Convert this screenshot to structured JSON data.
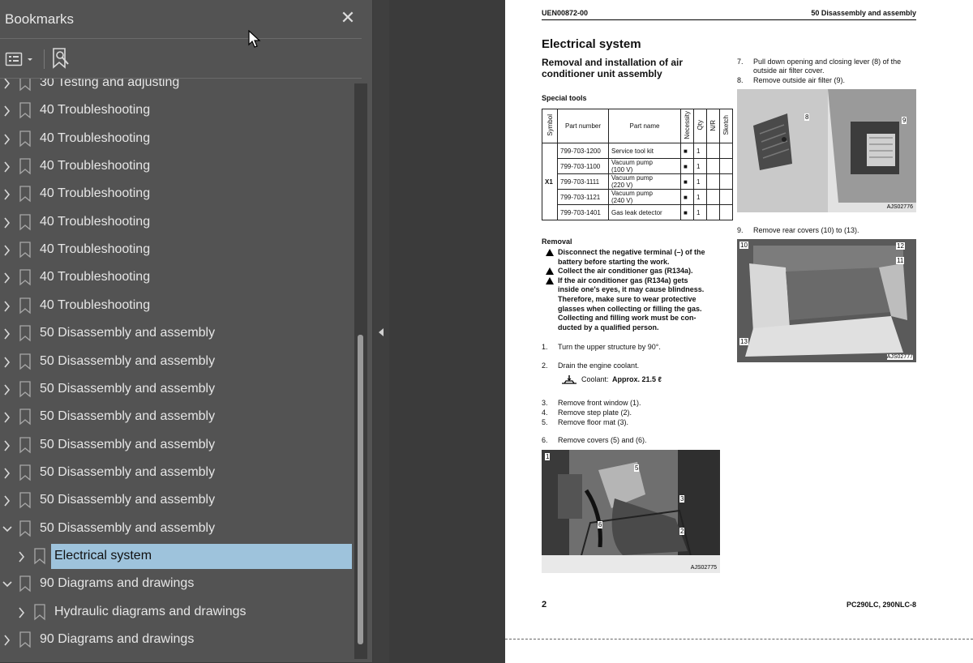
{
  "panel": {
    "title": "Bookmarks",
    "close_symbol": "✕"
  },
  "bookmarks": [
    {
      "label": "30 Testing and adjusting",
      "level": 0,
      "state": "collapsed"
    },
    {
      "label": "40 Troubleshooting",
      "level": 0,
      "state": "collapsed"
    },
    {
      "label": "40 Troubleshooting",
      "level": 0,
      "state": "collapsed"
    },
    {
      "label": "40 Troubleshooting",
      "level": 0,
      "state": "collapsed"
    },
    {
      "label": "40 Troubleshooting",
      "level": 0,
      "state": "collapsed"
    },
    {
      "label": "40 Troubleshooting",
      "level": 0,
      "state": "collapsed"
    },
    {
      "label": "40 Troubleshooting",
      "level": 0,
      "state": "collapsed"
    },
    {
      "label": "40 Troubleshooting",
      "level": 0,
      "state": "collapsed"
    },
    {
      "label": "40 Troubleshooting",
      "level": 0,
      "state": "collapsed"
    },
    {
      "label": "50 Disassembly and assembly",
      "level": 0,
      "state": "collapsed"
    },
    {
      "label": "50 Disassembly and assembly",
      "level": 0,
      "state": "collapsed"
    },
    {
      "label": "50 Disassembly and assembly",
      "level": 0,
      "state": "collapsed"
    },
    {
      "label": "50 Disassembly and assembly",
      "level": 0,
      "state": "collapsed"
    },
    {
      "label": "50 Disassembly and assembly",
      "level": 0,
      "state": "collapsed"
    },
    {
      "label": "50 Disassembly and assembly",
      "level": 0,
      "state": "collapsed"
    },
    {
      "label": "50 Disassembly and assembly",
      "level": 0,
      "state": "collapsed"
    },
    {
      "label": "50 Disassembly and assembly",
      "level": 0,
      "state": "expanded"
    },
    {
      "label": "Electrical system",
      "level": 1,
      "state": "collapsed",
      "selected": true
    },
    {
      "label": "90 Diagrams and drawings",
      "level": 0,
      "state": "expanded"
    },
    {
      "label": "Hydraulic diagrams and drawings",
      "level": 1,
      "state": "collapsed"
    },
    {
      "label": "90 Diagrams and drawings",
      "level": 0,
      "state": "collapsed"
    }
  ],
  "colors": {
    "panel_bg": "#535353",
    "selection_bg": "#9ec3dc",
    "viewer_bg": "#3b3b3b"
  },
  "doc": {
    "header_left": "UEN00872-00",
    "header_right": "50 Disassembly and assembly",
    "section_title": "Electrical system",
    "subtitle_line1": "Removal and installation of air",
    "subtitle_line2": "conditioner unit assembly",
    "special_tools": "Special tools",
    "table": {
      "headers": [
        "Symbol",
        "Part number",
        "Part name",
        "Necessity",
        "Qty",
        "N/R",
        "Sketch"
      ],
      "symbol": "X1",
      "rows": [
        {
          "part_number": "799-703-1200",
          "part_name": [
            "Service tool kit"
          ],
          "necessity": "■",
          "qty": "1"
        },
        {
          "part_number": "799-703-1100",
          "part_name": [
            "Vacuum pump",
            "(100 V)"
          ],
          "necessity": "■",
          "qty": "1"
        },
        {
          "part_number": "799-703-1111",
          "part_name": [
            "Vacuum pump",
            "(220 V)"
          ],
          "necessity": "■",
          "qty": "1"
        },
        {
          "part_number": "799-703-1121",
          "part_name": [
            "Vacuum pump",
            "(240 V)"
          ],
          "necessity": "■",
          "qty": "1"
        },
        {
          "part_number": "799-703-1401",
          "part_name": [
            "Gas leak detector"
          ],
          "necessity": "■",
          "qty": "1"
        }
      ]
    },
    "removal": "Removal",
    "warnings": [
      [
        "Disconnect the negative terminal (–) of the",
        "battery before starting the work."
      ],
      [
        "Collect the air conditioner gas (R134a)."
      ],
      [
        "If the air conditioner gas (R134a) gets",
        "inside one's eyes, it may cause blindness.",
        "Therefore, make sure to wear protective",
        "glasses when collecting or filling the gas.",
        "Collecting and filling work must be con-",
        "ducted by a qualified person."
      ]
    ],
    "steps_left": [
      {
        "num": "1.",
        "text": "Turn the upper structure by 90°."
      },
      {
        "num": "2.",
        "text": "Drain the engine coolant."
      },
      {
        "num": "3.",
        "text": "Remove front window (1)."
      },
      {
        "num": "4.",
        "text": "Remove step plate (2)."
      },
      {
        "num": "5.",
        "text": "Remove floor mat (3)."
      },
      {
        "num": "6.",
        "text": "Remove covers (5) and (6)."
      }
    ],
    "coolant_label": "Coolant: ",
    "coolant_value": "Approx. 21.5 ℓ",
    "steps_right": [
      {
        "num": "7.",
        "lines": [
          "Pull down opening and closing lever (8) of the",
          "outside air filter cover."
        ]
      },
      {
        "num": "8.",
        "lines": [
          "Remove outside air filter (9)."
        ]
      },
      {
        "num": "9.",
        "lines": [
          "Remove rear covers (10) to (13)."
        ]
      }
    ],
    "figures": [
      {
        "caption": "AJS02775",
        "callouts": [
          "1",
          "5",
          "3",
          "6",
          "2"
        ]
      },
      {
        "caption": "AJS02776",
        "callouts": [
          "8",
          "9"
        ]
      },
      {
        "caption": "AJS02777",
        "callouts": [
          "10",
          "12",
          "11",
          "13"
        ]
      }
    ],
    "page_number": "2",
    "footer_right": "PC290LC, 290NLC-8"
  }
}
